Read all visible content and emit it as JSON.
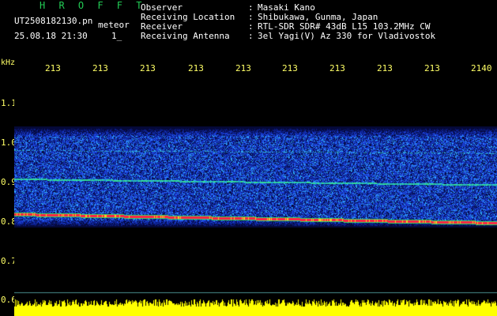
{
  "header": {
    "title": "H R O F F T",
    "filename": "UT2508182130.pn",
    "mode": "meteor",
    "timestamp": "25.08.18 21:30",
    "minute_marker": "1_"
  },
  "info": [
    {
      "label": "Observer",
      "value": "Masaki Kano"
    },
    {
      "label": "Receiving Location",
      "value": "Shibukawa, Gunma, Japan"
    },
    {
      "label": "Receiver",
      "value": "RTL-SDR SDR# 43dB L15 103.2MHz CW"
    },
    {
      "label": "Receiving Antenna",
      "value": "3el Yagi(V) Az 330 for Vladivostok"
    }
  ],
  "axes": {
    "y_unit": "kHz",
    "x_ticks": [
      "213",
      "213",
      "213",
      "213",
      "213",
      "213",
      "213",
      "213",
      "213",
      "2140"
    ],
    "y_ticks": [
      "1.1",
      "1.0",
      "0.9",
      "0.8",
      "0.7",
      "0.6"
    ]
  },
  "colors": {
    "title": "#22cc55",
    "ticks": "#ffff66",
    "noise": "#1a3fd8",
    "carrier": "#ff2244",
    "echo_line": "#33dd99",
    "signal_bar": "#ffff00"
  }
}
